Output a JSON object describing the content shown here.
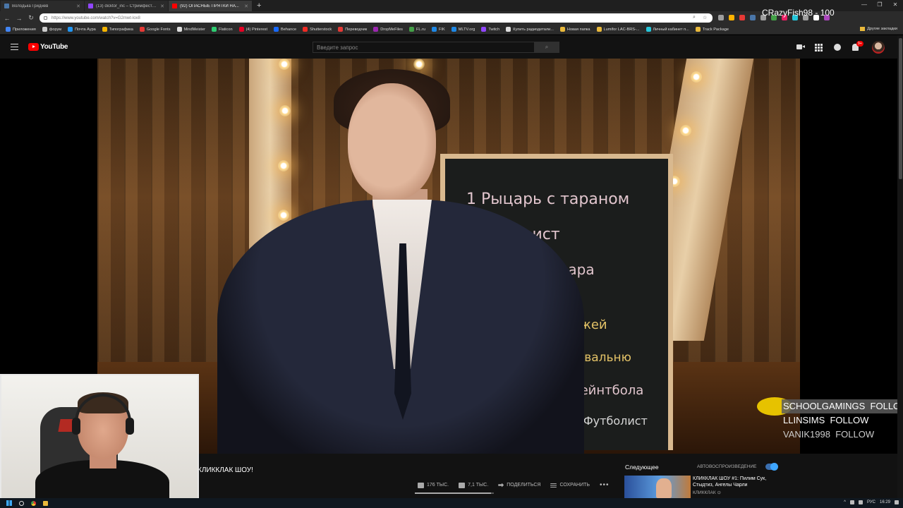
{
  "browser": {
    "tabs": [
      {
        "label": "Володька Гриднев",
        "color": "#4a76a8",
        "active": false
      },
      {
        "label": "(13) dicktor_inc – Стримфест 20...",
        "color": "#9146ff",
        "active": false
      },
      {
        "label": "(92) ОПАСНЫЕ ПРЯТКИ НА...",
        "color": "#ff0000",
        "active": true
      }
    ],
    "new_tab": "+",
    "url": "https://www.youtube.com/watch?v=G2mwt-lox8",
    "bookmarks": [
      {
        "label": "Приложения",
        "color": "#4285f4"
      },
      {
        "label": "форум",
        "color": "#cccccc"
      },
      {
        "label": "Почта Аура",
        "color": "#2196f3"
      },
      {
        "label": "Типографика",
        "color": "#f4b400"
      },
      {
        "label": "Google Fonts",
        "color": "#e53935"
      },
      {
        "label": "MindMeister",
        "color": "#dddddd"
      },
      {
        "label": "Flaticon",
        "color": "#2ecc71"
      },
      {
        "label": "(4) Pinterest",
        "color": "#e60023"
      },
      {
        "label": "Behance",
        "color": "#1769ff"
      },
      {
        "label": "Shutterstock",
        "color": "#ee2b24"
      },
      {
        "label": "Переводчик",
        "color": "#e53935"
      },
      {
        "label": "DropMeFiles",
        "color": "#9c27b0"
      },
      {
        "label": "FL.ru",
        "color": "#43a047"
      },
      {
        "label": "FIK",
        "color": "#1e88e5"
      },
      {
        "label": "MLTV.org",
        "color": "#1e88e5"
      },
      {
        "label": "Twitch",
        "color": "#9146ff"
      },
      {
        "label": "Купить радиодетали...",
        "color": "#dddddd"
      },
      {
        "label": "Новая папка",
        "color": "#e9b93b"
      },
      {
        "label": "Lumifor LAC-BRS-...",
        "color": "#e9b93b"
      },
      {
        "label": "Личный кабинет п...",
        "color": "#26c6da"
      },
      {
        "label": "Track Package",
        "color": "#e9b93b"
      }
    ],
    "other_bookmarks": "Другие закладки",
    "extensions": [
      "#9e9e9e",
      "#ffb300",
      "#e53935",
      "#4a76a8",
      "#9e9e9e",
      "#43a047",
      "#e91e63",
      "#26c6da",
      "#9e9e9e",
      "#ffffff",
      "#ab47bc"
    ]
  },
  "stream_overlay": {
    "title": "CRazyFish98 - 100",
    "follows": [
      {
        "name": "SCHOOLGAMINGS",
        "action": "FOLLOW"
      },
      {
        "name": "LLINSIMS",
        "action": "FOLLOW"
      },
      {
        "name": "VANIK1998",
        "action": "FOLLOW"
      }
    ]
  },
  "youtube": {
    "logo_text": "YouTube",
    "search_placeholder": "Введите запрос",
    "search_icon": "search-icon",
    "notification_count": "9+",
    "video_title": "КЛИККЛАК ШОУ!",
    "likes": "176 ТЫС.",
    "dislikes": "7,1 ТЫС.",
    "share_label": "ПОДЕЛИТЬСЯ",
    "save_label": "СОХРАНИТЬ",
    "more_label": "•••",
    "like_ratio": 0.96,
    "up_next_label": "Следующее",
    "autoplay_label": "АВТОВОСПРОИЗВЕДЕНИЕ",
    "autoplay_on": true,
    "next_video": {
      "title": "КЛИККЛАК ШОУ #1: Пилим Сук, Стыдтиз, Ангелы Чарли",
      "channel": "КЛИККЛАК ⊙"
    }
  },
  "chalkboard": [
    "1 Рыцарь с тараном",
    "оист",
    "Эльдара",
    "ль ножей",
    "наковальню",
    "ля Пейнтбола",
    "ий Футболист"
  ],
  "taskbar": {
    "language": "РУС",
    "time": "16:29"
  }
}
